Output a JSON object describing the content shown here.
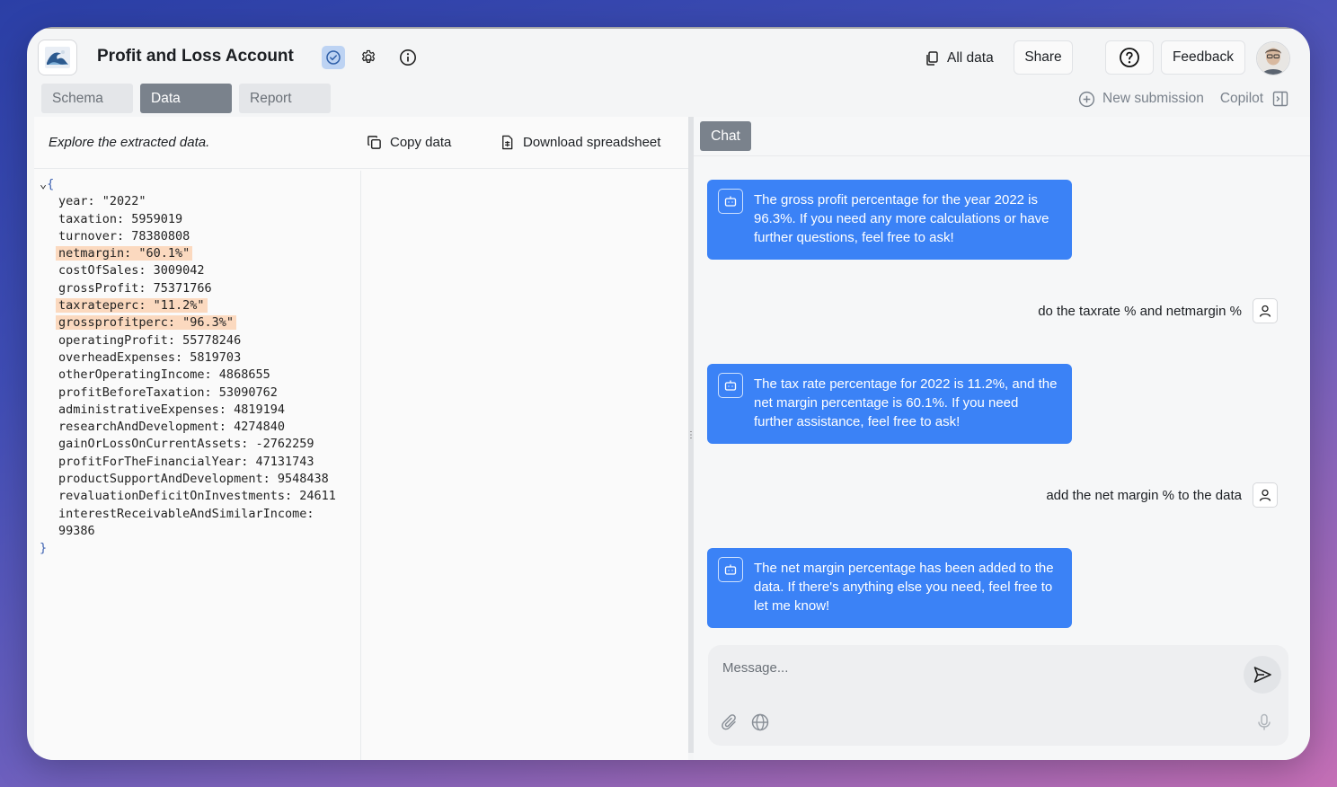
{
  "header": {
    "title": "Profit and Loss Account",
    "all_data_label": "All data",
    "share_label": "Share",
    "feedback_label": "Feedback"
  },
  "tabs": [
    {
      "label": "Schema",
      "active": false
    },
    {
      "label": "Data",
      "active": true
    },
    {
      "label": "Report",
      "active": false
    }
  ],
  "tabs_right": {
    "new_submission_label": "New submission",
    "copilot_label": "Copilot"
  },
  "data_panel": {
    "explore_text": "Explore the extracted data.",
    "copy_label": "Copy data",
    "download_label": "Download spreadsheet",
    "json_rows": [
      {
        "text": "year: \"2022\"",
        "highlight": false
      },
      {
        "text": "taxation: 5959019",
        "highlight": false
      },
      {
        "text": "turnover: 78380808",
        "highlight": false
      },
      {
        "text": "netmargin: \"60.1%\"",
        "highlight": true
      },
      {
        "text": "costOfSales: 3009042",
        "highlight": false
      },
      {
        "text": "grossProfit: 75371766",
        "highlight": false
      },
      {
        "text": "taxrateperc: \"11.2%\"",
        "highlight": true
      },
      {
        "text": "grossprofitperc: \"96.3%\"",
        "highlight": true
      },
      {
        "text": "operatingProfit: 55778246",
        "highlight": false
      },
      {
        "text": "overheadExpenses: 5819703",
        "highlight": false
      },
      {
        "text": "otherOperatingIncome: 4868655",
        "highlight": false
      },
      {
        "text": "profitBeforeTaxation: 53090762",
        "highlight": false
      },
      {
        "text": "administrativeExpenses: 4819194",
        "highlight": false
      },
      {
        "text": "researchAndDevelopment: 4274840",
        "highlight": false
      },
      {
        "text": "gainOrLossOnCurrentAssets: -2762259",
        "highlight": false
      },
      {
        "text": "profitForTheFinancialYear: 47131743",
        "highlight": false
      },
      {
        "text": "productSupportAndDevelopment: 9548438",
        "highlight": false
      },
      {
        "text": "revaluationDeficitOnInvestments: 24611",
        "highlight": false
      },
      {
        "text": "interestReceivableAndSimilarIncome:",
        "highlight": false
      },
      {
        "text": "99386",
        "highlight": false
      }
    ],
    "open_brace": "{",
    "close_brace": "}"
  },
  "chat": {
    "tab_label": "Chat",
    "messages": [
      {
        "role": "bot",
        "text": "The gross profit percentage for the year 2022 is 96.3%. If you need any more calculations or have further questions, feel free to ask!"
      },
      {
        "role": "user",
        "text": "do the taxrate % and netmargin %"
      },
      {
        "role": "bot",
        "text": "The tax rate percentage for 2022 is 11.2%, and the net margin percentage is 60.1%. If you need further assistance, feel free to ask!"
      },
      {
        "role": "user",
        "text": "add the net margin % to the data"
      },
      {
        "role": "bot",
        "text": "The net margin percentage has been added to the data. If there's anything else you need, feel free to let me know!"
      }
    ],
    "input_placeholder": "Message..."
  },
  "colors": {
    "accent": "#3b82f6",
    "highlight": "#fbd9bf",
    "active_tab": "#7a828c"
  }
}
